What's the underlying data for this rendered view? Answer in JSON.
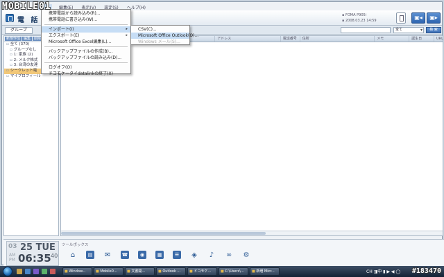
{
  "watermark": {
    "brand": "MOBILE01",
    "id": "#183470"
  },
  "menubar": {
    "items": [
      "",
      "編集(E)",
      "表示(V)",
      "設定(S)",
      "ヘルプ(H)"
    ],
    "active_index": 0
  },
  "header": {
    "title": "電 話 帳",
    "device_model": "FOMA P905i",
    "device_date": "2008.03.23 14:59",
    "btn_connect": "▣◂",
    "btn_exit": "▣▸"
  },
  "subbar": {
    "tab_label": "グループ",
    "search_scope": "全て",
    "search_button": "検 索"
  },
  "tree": {
    "toolbar": [
      "新規作成",
      "編集",
      "削除"
    ],
    "items": [
      {
        "label": "全て (370)",
        "level": 0,
        "selected": false
      },
      {
        "label": "グループなし",
        "level": 1,
        "selected": false
      },
      {
        "label": "1: 家族 (2)",
        "level": 1,
        "selected": false
      },
      {
        "label": "2: メルク株式",
        "level": 1,
        "selected": false
      },
      {
        "label": "3: 台湾の友達",
        "level": 1,
        "selected": false
      },
      {
        "label": "シークレット電",
        "level": 0,
        "selected": true
      },
      {
        "label": "マイプロフィール",
        "level": 0,
        "selected": false
      }
    ]
  },
  "grid": {
    "columns": [
      "",
      "",
      "アドレス",
      "電話番号",
      "住所",
      "メモ",
      "誕生日",
      "URL"
    ]
  },
  "dropdown": {
    "items": [
      {
        "label": "携帯電話から読み込み(R)...",
        "sep": false,
        "sub": false,
        "hl": false
      },
      {
        "label": "携帯電話に書き込み(W)...",
        "sep": false,
        "sub": false,
        "hl": false
      },
      {
        "label": "",
        "sep": true
      },
      {
        "label": "インポート(I)",
        "sep": false,
        "sub": true,
        "hl": true
      },
      {
        "label": "エクスポート(E)",
        "sep": false,
        "sub": true,
        "hl": false
      },
      {
        "label": "Microsoft Office Excel編集(L)...",
        "sep": false,
        "sub": false,
        "hl": false
      },
      {
        "label": "",
        "sep": true
      },
      {
        "label": "バックアップファイルの作成(B)...",
        "sep": false,
        "sub": false,
        "hl": false
      },
      {
        "label": "バックアップファイルの読み込み(D)...",
        "sep": false,
        "sub": false,
        "hl": false
      },
      {
        "label": "",
        "sep": true
      },
      {
        "label": "ログオフ(O)",
        "sep": false,
        "sub": false,
        "hl": false
      },
      {
        "label": "ドコモケータイdatalinkの終了(X)",
        "sep": false,
        "sub": false,
        "hl": false
      }
    ]
  },
  "submenu": {
    "items": [
      {
        "label": "CSV(C)...",
        "hl": false,
        "disabled": false
      },
      {
        "label": "Microsoft Office Outlook(O)...",
        "hl": true,
        "disabled": false
      },
      {
        "label": "Windows メール(S)...",
        "hl": false,
        "disabled": true
      }
    ]
  },
  "clock": {
    "month": "03",
    "date": "25",
    "weekday": "TUE",
    "am": "AM",
    "pm": "PM",
    "time": "06:35",
    "seconds": "40"
  },
  "tools": {
    "label": "ツールボックス",
    "icons": [
      "home-icon",
      "book-icon",
      "mail-icon",
      "phone-icon",
      "camera-icon",
      "schedule-icon",
      "list-icon",
      "video-icon",
      "music-icon",
      "link-icon",
      "settings-icon"
    ]
  },
  "taskbar": {
    "tasks": [
      "Window...",
      "Mobile0...",
      "文書開...",
      "Outlook ...",
      "ドコモケ...",
      "C:\\Users\\...",
      "新増 Micr..."
    ],
    "tray": "CH ◨中 ▮ ▶ ◀ ◯"
  }
}
